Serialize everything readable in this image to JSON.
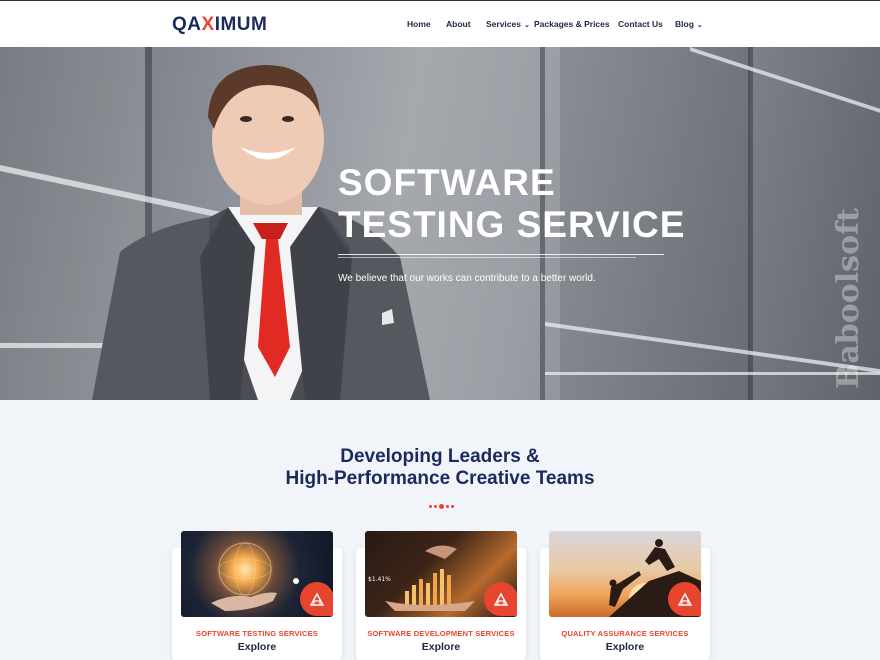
{
  "brand": {
    "logo_pre": "QA",
    "logo_x": "X",
    "logo_post": "IMUM"
  },
  "nav": {
    "items": [
      {
        "label": "Home"
      },
      {
        "label": "About"
      },
      {
        "label": "Services",
        "dropdown": "⌄"
      },
      {
        "label": "Packages & Prices"
      },
      {
        "label": "Contact Us"
      },
      {
        "label": "Blog",
        "dropdown": "⌄"
      }
    ]
  },
  "hero": {
    "title_line1": "SOFTWARE",
    "title_line2": "TESTING SERVICE",
    "subtitle": "We believe that our works can contribute to a better world.",
    "watermark": "Baboolsoft"
  },
  "section": {
    "title_line1": "Developing Leaders &",
    "title_line2": "High-Performance Creative Teams"
  },
  "cards": [
    {
      "category": "SOFTWARE TESTING SERVICES",
      "link": "Explore",
      "icon": "badge-icon"
    },
    {
      "category": "SOFTWARE DEVELOPMENT SERVICES",
      "link": "Explore",
      "icon": "badge-icon",
      "overlay_value": "$1.41%"
    },
    {
      "category": "QUALITY ASSURANCE SERVICES",
      "link": "Explore",
      "icon": "badge-icon"
    }
  ],
  "colors": {
    "accent": "#e8452e",
    "navy": "#1b2a5e",
    "background": "#f1f4f8"
  }
}
